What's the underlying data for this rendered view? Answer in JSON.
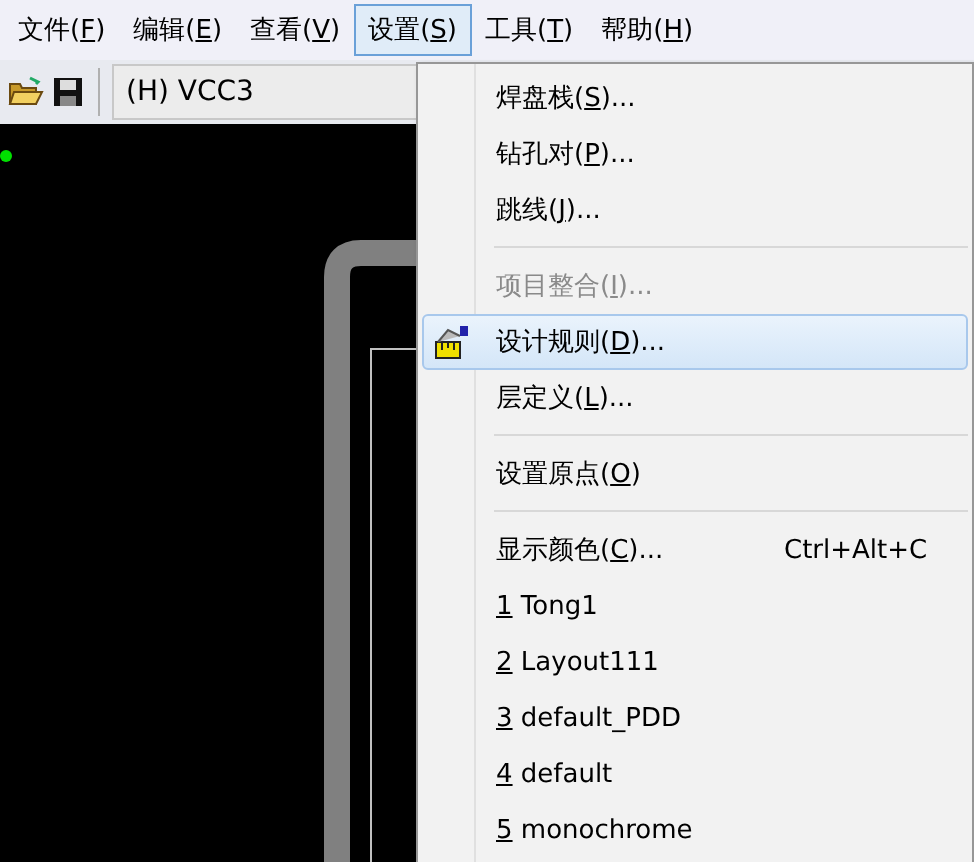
{
  "menubar": [
    {
      "before": "文件(",
      "key": "F",
      "after": ")",
      "selected": false
    },
    {
      "before": "编辑(",
      "key": "E",
      "after": ")",
      "selected": false
    },
    {
      "before": "查看(",
      "key": "V",
      "after": ")",
      "selected": false
    },
    {
      "before": "设置(",
      "key": "S",
      "after": ")",
      "selected": true
    },
    {
      "before": "工具(",
      "key": "T",
      "after": ")",
      "selected": false
    },
    {
      "before": "帮助(",
      "key": "H",
      "after": ")",
      "selected": false
    }
  ],
  "toolbar": {
    "layer_field": "(H) VCC3"
  },
  "menu": [
    {
      "kind": "item",
      "before": "焊盘栈(",
      "key": "S",
      "after": ")...",
      "disabled": false,
      "selected": false
    },
    {
      "kind": "item",
      "before": "钻孔对(",
      "key": "P",
      "after": ")...",
      "disabled": false,
      "selected": false
    },
    {
      "kind": "item",
      "before": "跳线(",
      "key": "J",
      "after": ")...",
      "disabled": false,
      "selected": false
    },
    {
      "kind": "separator"
    },
    {
      "kind": "item",
      "before": "项目整合(",
      "key": "I",
      "after": ")...",
      "disabled": true,
      "selected": false
    },
    {
      "kind": "item",
      "before": "设计规则(",
      "key": "D",
      "after": ")...",
      "disabled": false,
      "selected": true
    },
    {
      "kind": "item",
      "before": "层定义(",
      "key": "L",
      "after": ")...",
      "disabled": false,
      "selected": false
    },
    {
      "kind": "separator"
    },
    {
      "kind": "item",
      "before": "设置原点(",
      "key": "O",
      "after": ")",
      "disabled": false,
      "selected": false
    },
    {
      "kind": "separator"
    },
    {
      "kind": "item",
      "before": "显示颜色(",
      "key": "C",
      "after": ")...",
      "shortcut": "Ctrl+Alt+C",
      "disabled": false,
      "selected": false
    },
    {
      "kind": "item",
      "key": "1",
      "after": " Tong1",
      "disabled": false,
      "selected": false
    },
    {
      "kind": "item",
      "key": "2",
      "after": " Layout111",
      "disabled": false,
      "selected": false
    },
    {
      "kind": "item",
      "key": "3",
      "after": " default_PDD",
      "disabled": false,
      "selected": false
    },
    {
      "kind": "item",
      "key": "4",
      "after": " default",
      "disabled": false,
      "selected": false
    },
    {
      "kind": "item",
      "key": "5",
      "after": " monochrome",
      "disabled": false,
      "selected": false
    }
  ]
}
